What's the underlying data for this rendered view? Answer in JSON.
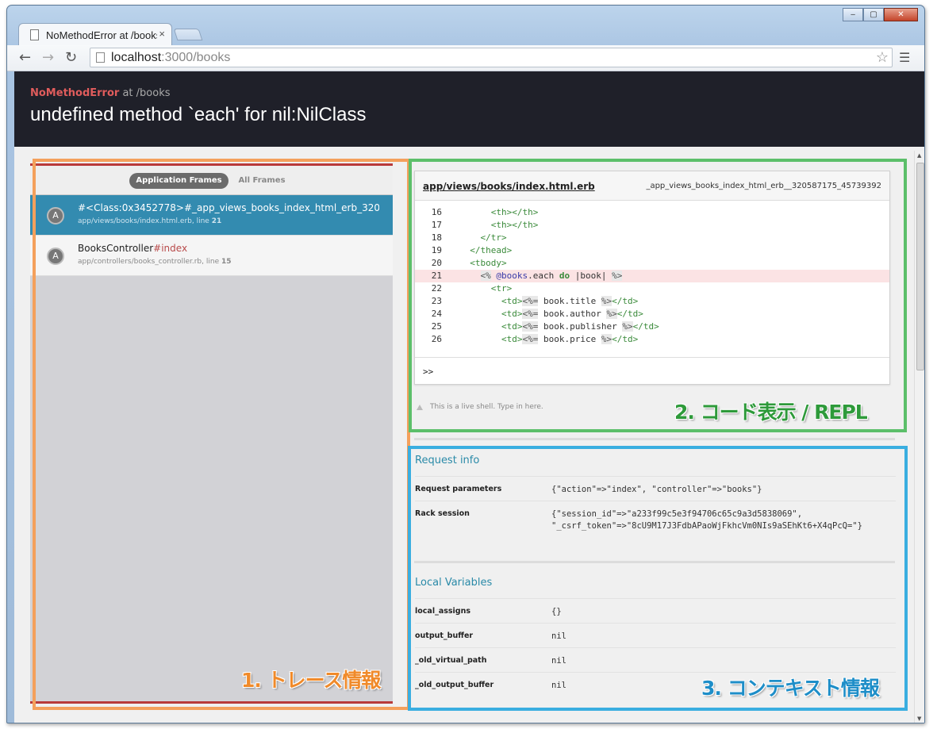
{
  "browser": {
    "tab_title": "NoMethodError at /books",
    "tab_close": "×",
    "url_host": "localhost",
    "url_rest": ":3000/books",
    "window_minimize": "‒",
    "window_maximize": "▢",
    "window_close": "✕"
  },
  "header": {
    "exception_name": "NoMethodError",
    "exception_at": " at /books",
    "message": "undefined method `each' for nil:NilClass"
  },
  "frames": {
    "tab_application": "Application Frames",
    "tab_all": "All Frames",
    "items": [
      {
        "badge": "A",
        "name_part1": "#<Class:0x3452778>",
        "name_part2": "#_app_views_books_index_html_erb_32058…",
        "file": "app/views/books/index.html.erb, line ",
        "line": "21"
      },
      {
        "badge": "A",
        "name_part1": "BooksController",
        "name_part2": "#index",
        "file": "app/controllers/books_controller.rb, line ",
        "line": "15"
      }
    ]
  },
  "code": {
    "file": "app/views/books/index.html.erb",
    "method": "_app_views_books_index_html_erb__320587175_45739392",
    "lines": [
      {
        "n": "16",
        "text": "      <th></th>"
      },
      {
        "n": "17",
        "text": "      <th></th>"
      },
      {
        "n": "18",
        "text": "    </tr>"
      },
      {
        "n": "19",
        "text": "  </thead>"
      },
      {
        "n": "20",
        "text": "  <tbody>"
      },
      {
        "n": "21",
        "text": "    <% @books.each do |book| %>"
      },
      {
        "n": "22",
        "text": "      <tr>"
      },
      {
        "n": "23",
        "text": "        <td><%= book.title %></td>"
      },
      {
        "n": "24",
        "text": "        <td><%= book.author %></td>"
      },
      {
        "n": "25",
        "text": "        <td><%= book.publisher %></td>"
      },
      {
        "n": "26",
        "text": "        <td><%= book.price %></td>"
      }
    ],
    "highlight_line": "21",
    "repl_prompt": ">>",
    "shell_note": "This is a live shell. Type in here."
  },
  "request_info": {
    "title": "Request info",
    "rows": [
      {
        "key": "Request parameters",
        "value": "{\"action\"=>\"index\", \"controller\"=>\"books\"}"
      },
      {
        "key": "Rack session",
        "value": "{\"session_id\"=>\"a233f99c5e3f94706c65c9a3d5838069\",\n\"_csrf_token\"=>\"8cU9M17J3FdbAPaoWjFkhcVm0NIs9aSEhKt6+X4qPcQ=\"}"
      }
    ]
  },
  "local_variables": {
    "title": "Local Variables",
    "rows": [
      {
        "key": "local_assigns",
        "value": "{}"
      },
      {
        "key": "output_buffer",
        "value": "nil"
      },
      {
        "key": "_old_virtual_path",
        "value": "nil"
      },
      {
        "key": "_old_output_buffer",
        "value": "nil"
      }
    ]
  },
  "annotations": {
    "trace": "1. トレース情報",
    "code_repl": "2. コード表示 / REPL",
    "context": "3. コンテキスト情報"
  },
  "colors": {
    "trace_box": "#f4a05c",
    "code_box": "#5cbf6a",
    "context_box": "#3aaee0",
    "selected_frame": "#338bb0",
    "header_bg": "#1f2029"
  }
}
